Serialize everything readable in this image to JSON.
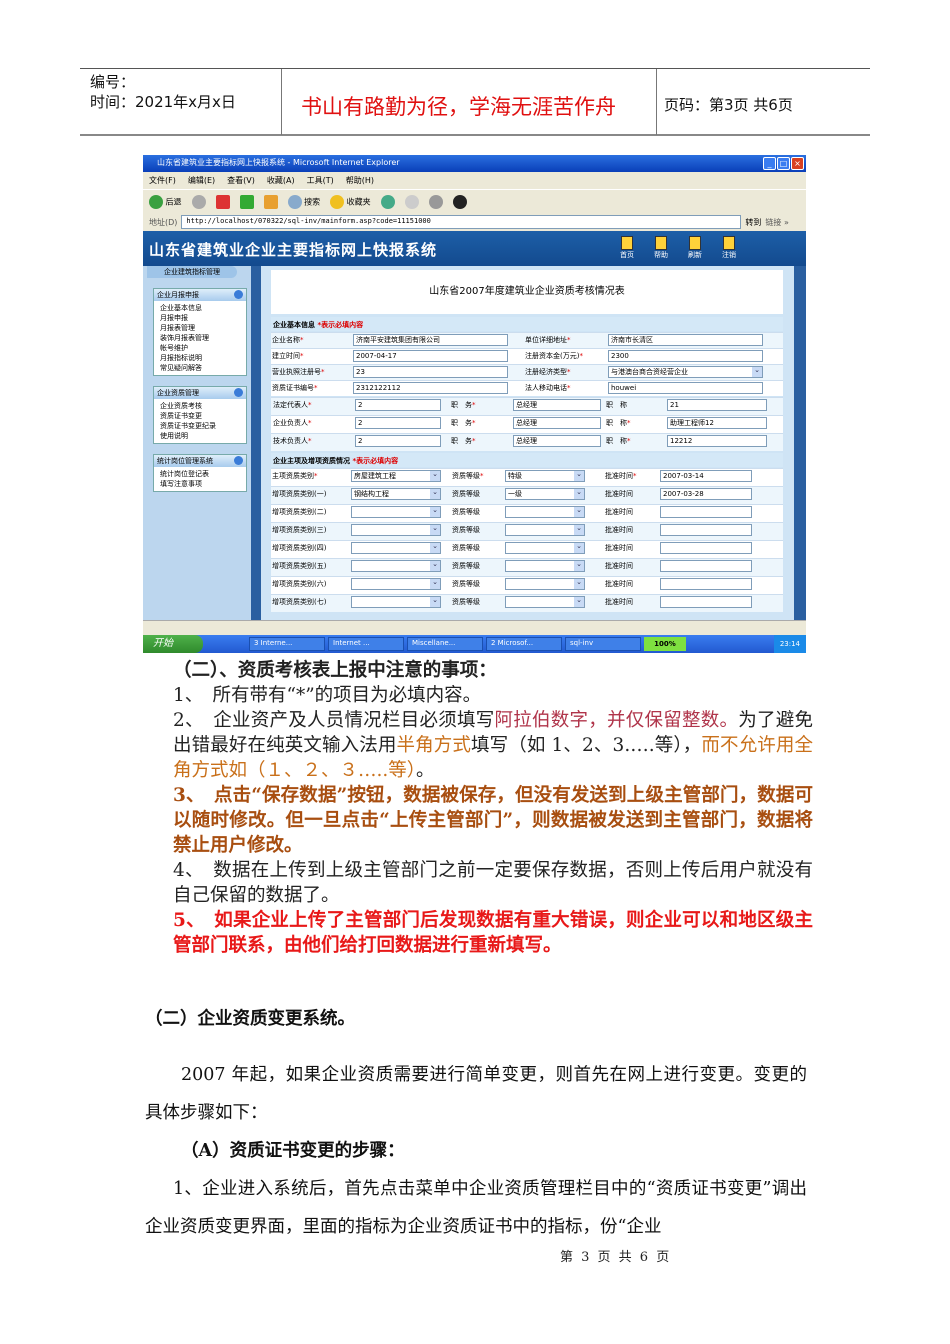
{
  "header": {
    "number_label": "编号：",
    "date_label": "时间：2021年x月x日",
    "motto": "书山有路勤为径，学海无涯苦作舟",
    "page_info": "页码：第3页  共6页"
  },
  "browser": {
    "title": "山东省建筑业主要指标网上快报系统 - Microsoft Internet Explorer",
    "menu": [
      "文件(F)",
      "编辑(E)",
      "查看(V)",
      "收藏(A)",
      "工具(T)",
      "帮助(H)"
    ],
    "toolbar": {
      "back": "后退",
      "search": "搜索",
      "favorites": "收藏夹"
    },
    "address_label": "地址(D)",
    "url": "http://localhost/070322/sql-inv/mainform.asp?code=11151000",
    "go": "转到",
    "links": "链接 »"
  },
  "app": {
    "title": "山东省建筑业企业主要指标网上快报系统",
    "nav": [
      "首页",
      "帮助",
      "刷新",
      "注销"
    ],
    "sidebar_top": "企业建筑指标管理",
    "groups": [
      {
        "title": "企业月报申报",
        "items": [
          "企业基本信息",
          "月报申报",
          "月报表管理",
          "装饰月报表管理",
          "帐号维护",
          "月报指标说明",
          "常见疑问解答"
        ]
      },
      {
        "title": "企业资质管理",
        "items": [
          "企业资质考核",
          "资质证书变更",
          "资质证书变更纪录",
          "使用说明"
        ]
      },
      {
        "title": "统计岗位管理系统",
        "items": [
          "统计岗位登记表",
          "填写注意事项"
        ]
      }
    ],
    "form_title": "山东省2007年度建筑业企业资质考核情况表",
    "sec1": "企业基本信息",
    "sec2": "企业主项及增项资质情况",
    "req_note": "*表示必填内容",
    "basic": [
      {
        "l1": "企业名称",
        "v1": "济南平安建筑集团有限公司",
        "l2": "单位详细地址",
        "v2": "济南市长清区"
      },
      {
        "l1": "建立时间",
        "v1": "2007-04-17",
        "l2": "注册资本金(万元)",
        "v2": "2300"
      },
      {
        "l1": "营业执照注册号",
        "v1": "23",
        "l2": "注册经济类型",
        "v2": "与港澳台商合资经营企业"
      },
      {
        "l1": "资质证书编号",
        "v1": "2312122112",
        "l2": "法人移动电话",
        "v2": "houwei"
      }
    ],
    "people": [
      {
        "role": "法定代表人",
        "name": "2",
        "duty_label": "职　务",
        "duty": "总经理",
        "title_label": "职　称",
        "title": "21"
      },
      {
        "role": "企业负责人",
        "name": "2",
        "duty_label": "职　务",
        "duty": "总经理",
        "title_label": "职　称",
        "title": "助理工程师12"
      },
      {
        "role": "技术负责人",
        "name": "2",
        "duty_label": "职　务",
        "duty": "总经理",
        "title_label": "职　称",
        "title": "12212"
      }
    ],
    "quals": [
      {
        "label": "主项资质类别",
        "type": "房屋建筑工程",
        "grade_label": "资质等级",
        "grade": "特级",
        "date_label": "批准时间",
        "date": "2007-03-14"
      },
      {
        "label": "增项资质类别(一)",
        "type": "钢结构工程",
        "grade_label": "资质等级",
        "grade": "一级",
        "date_label": "批准时间",
        "date": "2007-03-28"
      },
      {
        "label": "增项资质类别(二)",
        "type": "",
        "grade_label": "资质等级",
        "grade": "",
        "date_label": "批准时间",
        "date": ""
      },
      {
        "label": "增项资质类别(三)",
        "type": "",
        "grade_label": "资质等级",
        "grade": "",
        "date_label": "批准时间",
        "date": ""
      },
      {
        "label": "增项资质类别(四)",
        "type": "",
        "grade_label": "资质等级",
        "grade": "",
        "date_label": "批准时间",
        "date": ""
      },
      {
        "label": "增项资质类别(五)",
        "type": "",
        "grade_label": "资质等级",
        "grade": "",
        "date_label": "批准时间",
        "date": ""
      },
      {
        "label": "增项资质类别(六)",
        "type": "",
        "grade_label": "资质等级",
        "grade": "",
        "date_label": "批准时间",
        "date": ""
      },
      {
        "label": "增项资质类别(七)",
        "type": "",
        "grade_label": "资质等级",
        "grade": "",
        "date_label": "批准时间",
        "date": ""
      }
    ]
  },
  "taskbar": {
    "start": "开始",
    "tasks": [
      "3 Interne...",
      "Internet ...",
      "Miscellane...",
      "2 Microsof...",
      "sql-inv"
    ],
    "zoom": "100%",
    "clock": "23:14"
  },
  "notes": {
    "heading": "（二）、资质考核表上报中注意的事项：",
    "n1": "1、　所有带有“*”的项目为必填内容。",
    "n2a": "2、　企业资产及人员情况栏目必须填写",
    "n2b": "阿拉伯数字，并仅保留整数。",
    "n2c": "为了避免出错最好在纯英文输入法用",
    "n2d": "半角方式",
    "n2e": "填写（如 1、2、3.….等），",
    "n2f": "而不允许用全角方式如（１、２、３…..等）",
    "n2g": "。",
    "n3": "3、　点击“保存数据”按钮，数据被保存，但没有发送到上级主管部门，数据可以随时修改。但一旦点击“上传主管部门”，则数据被发送到主管部门，数据将禁止用户修改。",
    "n4": "4、　数据在上传到上级主管部门之前一定要保存数据，否则上传后用户就没有自己保留的数据了。",
    "n5": "5、　如果企业上传了主管部门后发现数据有重大错误，则企业可以和地区级主管部门联系，由他们给打回数据进行重新填写。"
  },
  "section2": {
    "heading": "（二）企业资质变更系统。",
    "p1": "2007 年起，如果企业资质需要进行简单变更，则首先在网上进行变更。变更的具体步骤如下：",
    "sub": "（A）资质证书变更的步骤：",
    "p2": "1、企业进入系统后，首先点击菜单中企业资质管理栏目中的“资质证书变更”调出企业资质变更界面，里面的指标为企业资质证书中的指标，份“企业"
  },
  "footer": "第 3 页 共 6 页"
}
